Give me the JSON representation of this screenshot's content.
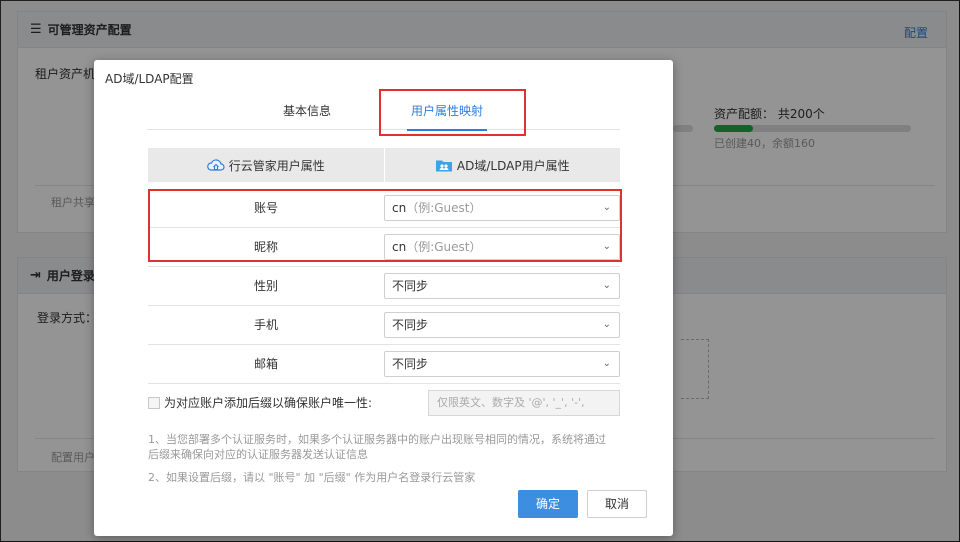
{
  "background": {
    "panel1": {
      "title": "可管理资产配置",
      "link": "配置",
      "tenant_label": "租户资产机",
      "quota_label": "资产配额：  共200个",
      "quota_sub": "已创建40，余额160",
      "quota_progress": 0.2,
      "footer_text": "租户共享"
    },
    "panel2": {
      "title": "用户登录",
      "login_mode_label": "登录方式：",
      "footer_text": "配置用户"
    }
  },
  "dialog": {
    "title": "AD域/LDAP配置",
    "tabs": [
      {
        "label": "基本信息"
      },
      {
        "label": "用户属性映射"
      }
    ],
    "active_tab": 1,
    "table": {
      "left_header": "行云管家用户属性",
      "right_header": "AD域/LDAP用户属性",
      "rows": [
        {
          "label": "账号",
          "value": "cn",
          "hint": "（例:Guest）"
        },
        {
          "label": "昵称",
          "value": "cn",
          "hint": "（例:Guest）"
        },
        {
          "label": "性别",
          "value": "不同步",
          "hint": ""
        },
        {
          "label": "手机",
          "value": "不同步",
          "hint": ""
        },
        {
          "label": "邮箱",
          "value": "不同步",
          "hint": ""
        }
      ]
    },
    "suffix": {
      "label": "为对应账户添加后缀以确保账户唯一性:",
      "placeholder": "仅限英文、数字及 '@', '_', '-',"
    },
    "notes": [
      "1、当您部署多个认证服务时，如果多个认证服务器中的账户出现账号相同的情况，系统将通过 后缀来确保向对应的认证服务器发送认证信息",
      "2、如果设置后缀，请以 \"账号\" 加 \"后缀\" 作为用户名登录行云管家"
    ],
    "buttons": {
      "ok": "确定",
      "cancel": "取消"
    }
  },
  "colors": {
    "accent": "#2b7de1",
    "highlight": "#e0312f",
    "progress": "#27a844",
    "primary_button": "#3d8ee0"
  }
}
